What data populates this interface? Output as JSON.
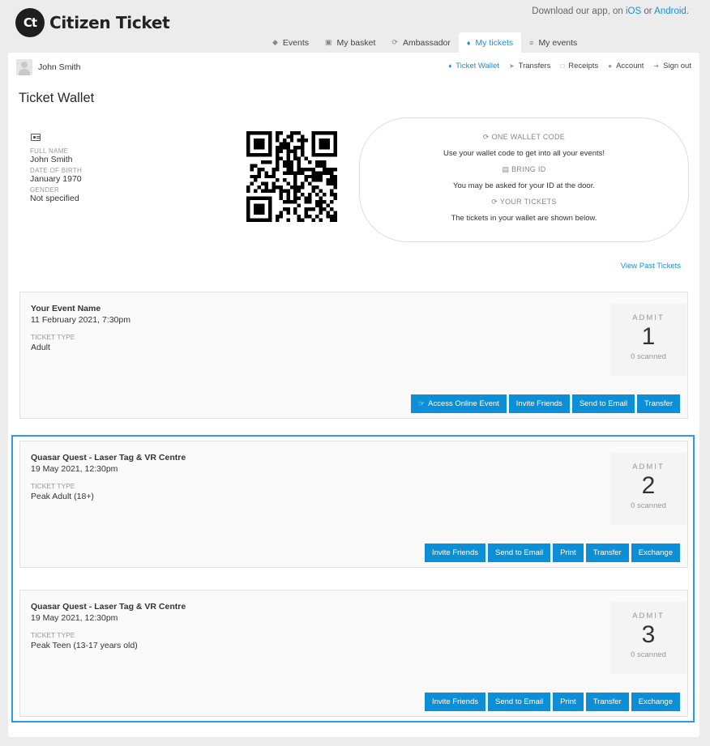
{
  "header": {
    "logo_mark": "Ct",
    "logo_text": "Citizen Ticket",
    "app_prefix": "Download our app, on ",
    "app_ios": "iOS",
    "app_or": " or ",
    "app_android": "Android",
    "app_suffix": "."
  },
  "nav": [
    {
      "label": "Events",
      "icon": "tag-icon"
    },
    {
      "label": "My basket",
      "icon": "basket-icon"
    },
    {
      "label": "Ambassador",
      "icon": "refresh-icon"
    },
    {
      "label": "My tickets",
      "icon": "ticket-icon",
      "active": true
    },
    {
      "label": "My events",
      "icon": "sliders-icon"
    }
  ],
  "user": {
    "name": "John Smith"
  },
  "subnav": [
    {
      "label": "Ticket Wallet",
      "icon": "ticket-icon",
      "active": true
    },
    {
      "label": "Transfers",
      "icon": "send-icon"
    },
    {
      "label": "Receipts",
      "icon": "file-icon"
    },
    {
      "label": "Account",
      "icon": "user-icon"
    },
    {
      "label": "Sign out",
      "icon": "signout-icon"
    }
  ],
  "page_title": "Ticket Wallet",
  "profile": {
    "full_name_label": "FULL NAME",
    "full_name": "John Smith",
    "dob_label": "DATE OF BIRTH",
    "dob": "January 1970",
    "gender_label": "GENDER",
    "gender": "Not specified"
  },
  "info": {
    "wallet_code_heading": "ONE WALLET CODE",
    "wallet_code_text": "Use your wallet code to get into all your events!",
    "bring_id_heading": "BRING ID",
    "bring_id_text": "You may be asked for your ID at the door.",
    "your_tickets_heading": "YOUR TICKETS",
    "your_tickets_text": "The tickets in your wallet are shown below."
  },
  "view_past": "View Past Tickets",
  "ticket_type_label": "TICKET TYPE",
  "admit_label": "ADMIT",
  "tickets": [
    {
      "name": "Your Event Name",
      "date": "11 February 2021, 7:30pm",
      "type": "Adult",
      "admit": "1",
      "scanned": "0 scanned",
      "buttons": [
        "Access Online Event",
        "Invite Friends",
        "Send to Email",
        "Transfer"
      ]
    },
    {
      "name": "Quasar Quest - Laser Tag & VR Centre",
      "date": "19 May 2021, 12:30pm",
      "type": "Peak Adult (18+)",
      "admit": "2",
      "scanned": "0 scanned",
      "buttons": [
        "Invite Friends",
        "Send to Email",
        "Print",
        "Transfer",
        "Exchange"
      ]
    },
    {
      "name": "Quasar Quest - Laser Tag & VR Centre",
      "date": "19 May 2021, 12:30pm",
      "type": "Peak Teen (13-17 years old)",
      "admit": "3",
      "scanned": "0 scanned",
      "buttons": [
        "Invite Friends",
        "Send to Email",
        "Print",
        "Transfer",
        "Exchange"
      ]
    }
  ],
  "colors": {
    "accent": "#0c8fd6",
    "highlight_border": "#2e9be8",
    "background": "#ececec"
  }
}
